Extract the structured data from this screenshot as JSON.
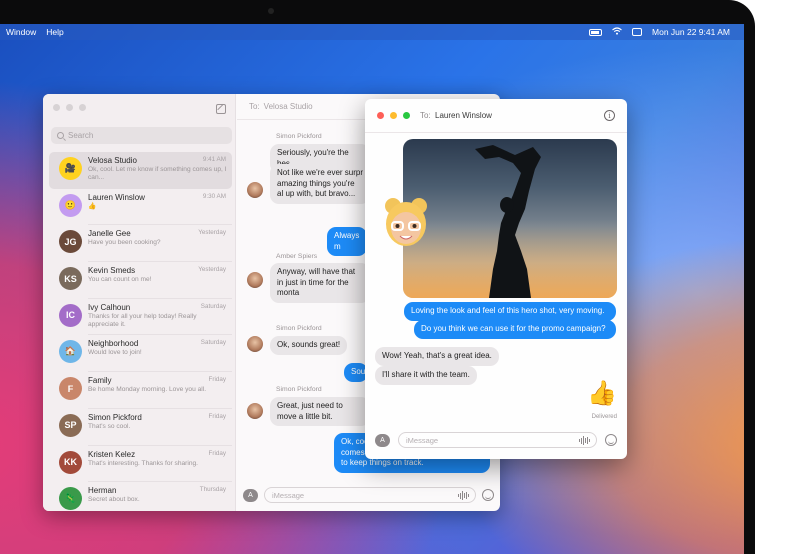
{
  "menubar": {
    "items": [
      "Window",
      "Help"
    ],
    "clock": "Mon Jun 22  9:41 AM",
    "icons": [
      "battery-icon",
      "wifi-icon",
      "control-center-icon"
    ]
  },
  "main_window": {
    "search_placeholder": "Search",
    "to_label": "To:",
    "to_name": "Velosa Studio",
    "conversations": [
      {
        "name": "Velosa Studio",
        "preview": "Ok, cool. Let me know if something comes up, I can...",
        "time": "9:41 AM",
        "active": true,
        "avatar_color": "#ffd21f",
        "avatar_text": "🎥"
      },
      {
        "name": "Lauren Winslow",
        "preview": "👍",
        "time": "9:30 AM",
        "active": false,
        "avatar_color": "#c39bf0",
        "avatar_text": "🙂"
      },
      {
        "name": "Janelle Gee",
        "preview": "Have you been cooking?",
        "time": "Yesterday",
        "active": false,
        "avatar_color": "#6b4a3a",
        "avatar_text": "JG"
      },
      {
        "name": "Kevin Smeds",
        "preview": "You can count on me!",
        "time": "Yesterday",
        "active": false,
        "avatar_color": "#7a6a5c",
        "avatar_text": "KS"
      },
      {
        "name": "Ivy Calhoun",
        "preview": "Thanks for all your help today! Really appreciate it.",
        "time": "Saturday",
        "active": false,
        "avatar_color": "#a36cc8",
        "avatar_text": "IC"
      },
      {
        "name": "Neighborhood",
        "preview": "Would love to join!",
        "time": "Saturday",
        "active": false,
        "avatar_color": "#6fb6e8",
        "avatar_text": "🏠"
      },
      {
        "name": "Family",
        "preview": "Be home Monday morning. Love you all.",
        "time": "Friday",
        "active": false,
        "avatar_color": "#c9866a",
        "avatar_text": "F"
      },
      {
        "name": "Simon Pickford",
        "preview": "That's so cool.",
        "time": "Friday",
        "active": false,
        "avatar_color": "#8a6b55",
        "avatar_text": "SP"
      },
      {
        "name": "Kristen Kelez",
        "preview": "That's interesting. Thanks for sharing.",
        "time": "Friday",
        "active": false,
        "avatar_color": "#a24a3a",
        "avatar_text": "KK"
      },
      {
        "name": "Herman",
        "preview": "Secret about box.",
        "time": "Thursday",
        "active": false,
        "avatar_color": "#3a9a4a",
        "avatar_text": "🦎"
      }
    ],
    "messages": [
      {
        "kind": "sender",
        "text": "Simon Pickford"
      },
      {
        "kind": "gray",
        "text": "Seriously, you're the bes"
      },
      {
        "kind": "gray",
        "text": "Not like we're ever surpr amazing things you're al up with, but bravo..."
      },
      {
        "kind": "blue",
        "text": "Always m"
      },
      {
        "kind": "sender",
        "text": "Amber Spiers"
      },
      {
        "kind": "gray",
        "text": "Anyway, will have that in just in time for the monta"
      },
      {
        "kind": "sender",
        "text": "Simon Pickford"
      },
      {
        "kind": "gray",
        "text": "Ok, sounds great!"
      },
      {
        "kind": "blue",
        "text": "Sou"
      },
      {
        "kind": "sender",
        "text": "Simon Pickford"
      },
      {
        "kind": "gray",
        "text": "Great, just need to move a little bit."
      },
      {
        "kind": "blue",
        "text": "Ok, cool. Let me know if something comes up, I can try to formulate a plan to keep things on track."
      }
    ],
    "input_placeholder": "iMessage"
  },
  "front_window": {
    "to_label": "To:",
    "to_name": "Lauren Winslow",
    "info_glyph": "i",
    "messages": [
      {
        "kind": "blue",
        "text": "Loving the look and feel of this hero shot, very moving."
      },
      {
        "kind": "blue",
        "text": "Do you think we can use it for the promo campaign?"
      },
      {
        "kind": "gray",
        "text": "Wow! Yeah, that's a great idea."
      },
      {
        "kind": "gray",
        "text": "I'll share it with the team."
      }
    ],
    "thumbs": "👍",
    "delivered": "Delivered",
    "input_placeholder": "iMessage"
  },
  "colors": {
    "imessage_blue": "#1d8bf7",
    "bubble_gray": "#e9e6e8",
    "sidebar_bg": "#f3eef0"
  }
}
